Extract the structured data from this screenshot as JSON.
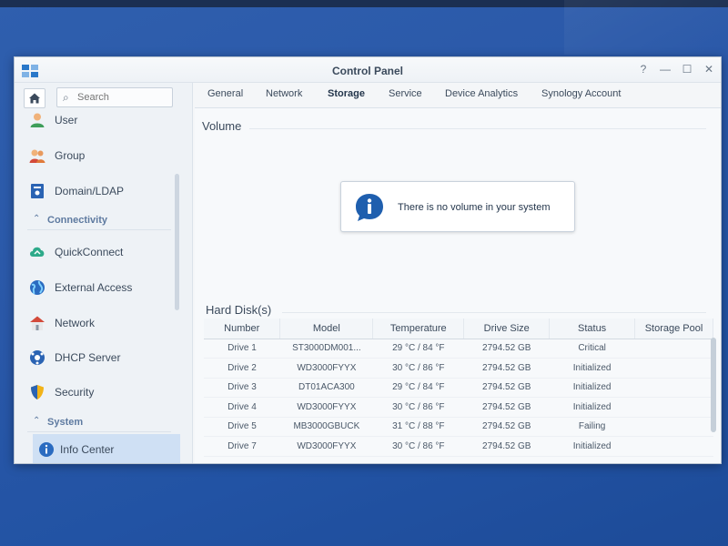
{
  "window": {
    "title": "Control Panel"
  },
  "window_controls": {
    "help": "?",
    "minimize": "—",
    "maximize": "☐",
    "close": "✕"
  },
  "search": {
    "placeholder": "Search"
  },
  "sidebar": {
    "items": [
      {
        "label": "User",
        "icon": "user-icon"
      },
      {
        "label": "Group",
        "icon": "group-icon"
      },
      {
        "label": "Domain/LDAP",
        "icon": "domain-icon"
      },
      {
        "section": "Connectivity"
      },
      {
        "label": "QuickConnect",
        "icon": "quickconnect-icon"
      },
      {
        "label": "External Access",
        "icon": "globe-icon"
      },
      {
        "label": "Network",
        "icon": "network-house-icon"
      },
      {
        "label": "DHCP Server",
        "icon": "dhcp-icon"
      },
      {
        "label": "Security",
        "icon": "shield-icon"
      },
      {
        "section": "System"
      },
      {
        "label": "Info Center",
        "icon": "info-icon",
        "active": true
      }
    ]
  },
  "tabs": [
    {
      "label": "General"
    },
    {
      "label": "Network"
    },
    {
      "label": "Storage",
      "active": true
    },
    {
      "label": "Service"
    },
    {
      "label": "Device Analytics"
    },
    {
      "label": "Synology Account"
    }
  ],
  "volume": {
    "title": "Volume",
    "notice": "There is no volume in your system"
  },
  "hard_disks": {
    "title": "Hard Disk(s)",
    "columns": [
      "Number",
      "Model",
      "Temperature",
      "Drive Size",
      "Status",
      "Storage Pool"
    ],
    "rows": [
      [
        "Drive 1",
        "ST3000DM001...",
        "29 °C / 84 °F",
        "2794.52 GB",
        "Critical",
        ""
      ],
      [
        "Drive 2",
        "WD3000FYYX",
        "30 °C / 86 °F",
        "2794.52 GB",
        "Initialized",
        ""
      ],
      [
        "Drive 3",
        "DT01ACA300",
        "29 °C / 84 °F",
        "2794.52 GB",
        "Initialized",
        ""
      ],
      [
        "Drive 4",
        "WD3000FYYX",
        "30 °C / 86 °F",
        "2794.52 GB",
        "Initialized",
        ""
      ],
      [
        "Drive 5",
        "MB3000GBUCK",
        "31 °C / 88 °F",
        "2794.52 GB",
        "Failing",
        ""
      ],
      [
        "Drive 7",
        "WD3000FYYX",
        "30 °C / 86 °F",
        "2794.52 GB",
        "Initialized",
        ""
      ]
    ]
  },
  "colors": {
    "status_critical": "#d43b26",
    "status_initialized": "#2f9a2f",
    "status_failing": "#d43b26",
    "accent": "#2a78c9"
  }
}
